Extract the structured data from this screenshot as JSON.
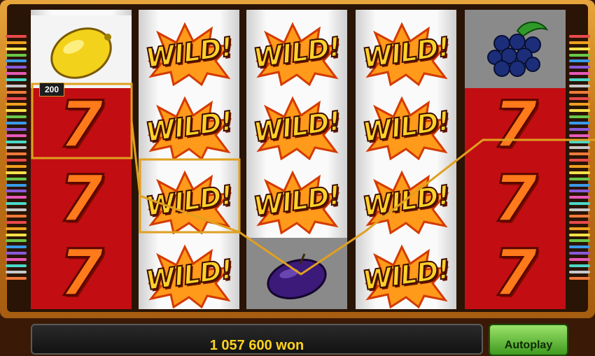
{
  "game": {
    "win_message": "1 057 600 won",
    "autoplay_label": "Autoplay",
    "line_win_value": "200",
    "wild_label": "WILD!",
    "seven_label": "7"
  },
  "reels": [
    [
      "lemon",
      "seven",
      "seven",
      "seven"
    ],
    [
      "wild",
      "wild",
      "wild",
      "wild"
    ],
    [
      "wild",
      "wild",
      "wild",
      "plum"
    ],
    [
      "wild",
      "wild",
      "wild",
      "wild"
    ],
    [
      "grapes",
      "seven",
      "seven",
      "seven"
    ]
  ],
  "colors": {
    "frame": "#c27618",
    "seven_bg": "#c20e12",
    "payline": "#e8a21a",
    "win_text": "#ffd21f",
    "autoplay": "#5fbf35"
  }
}
